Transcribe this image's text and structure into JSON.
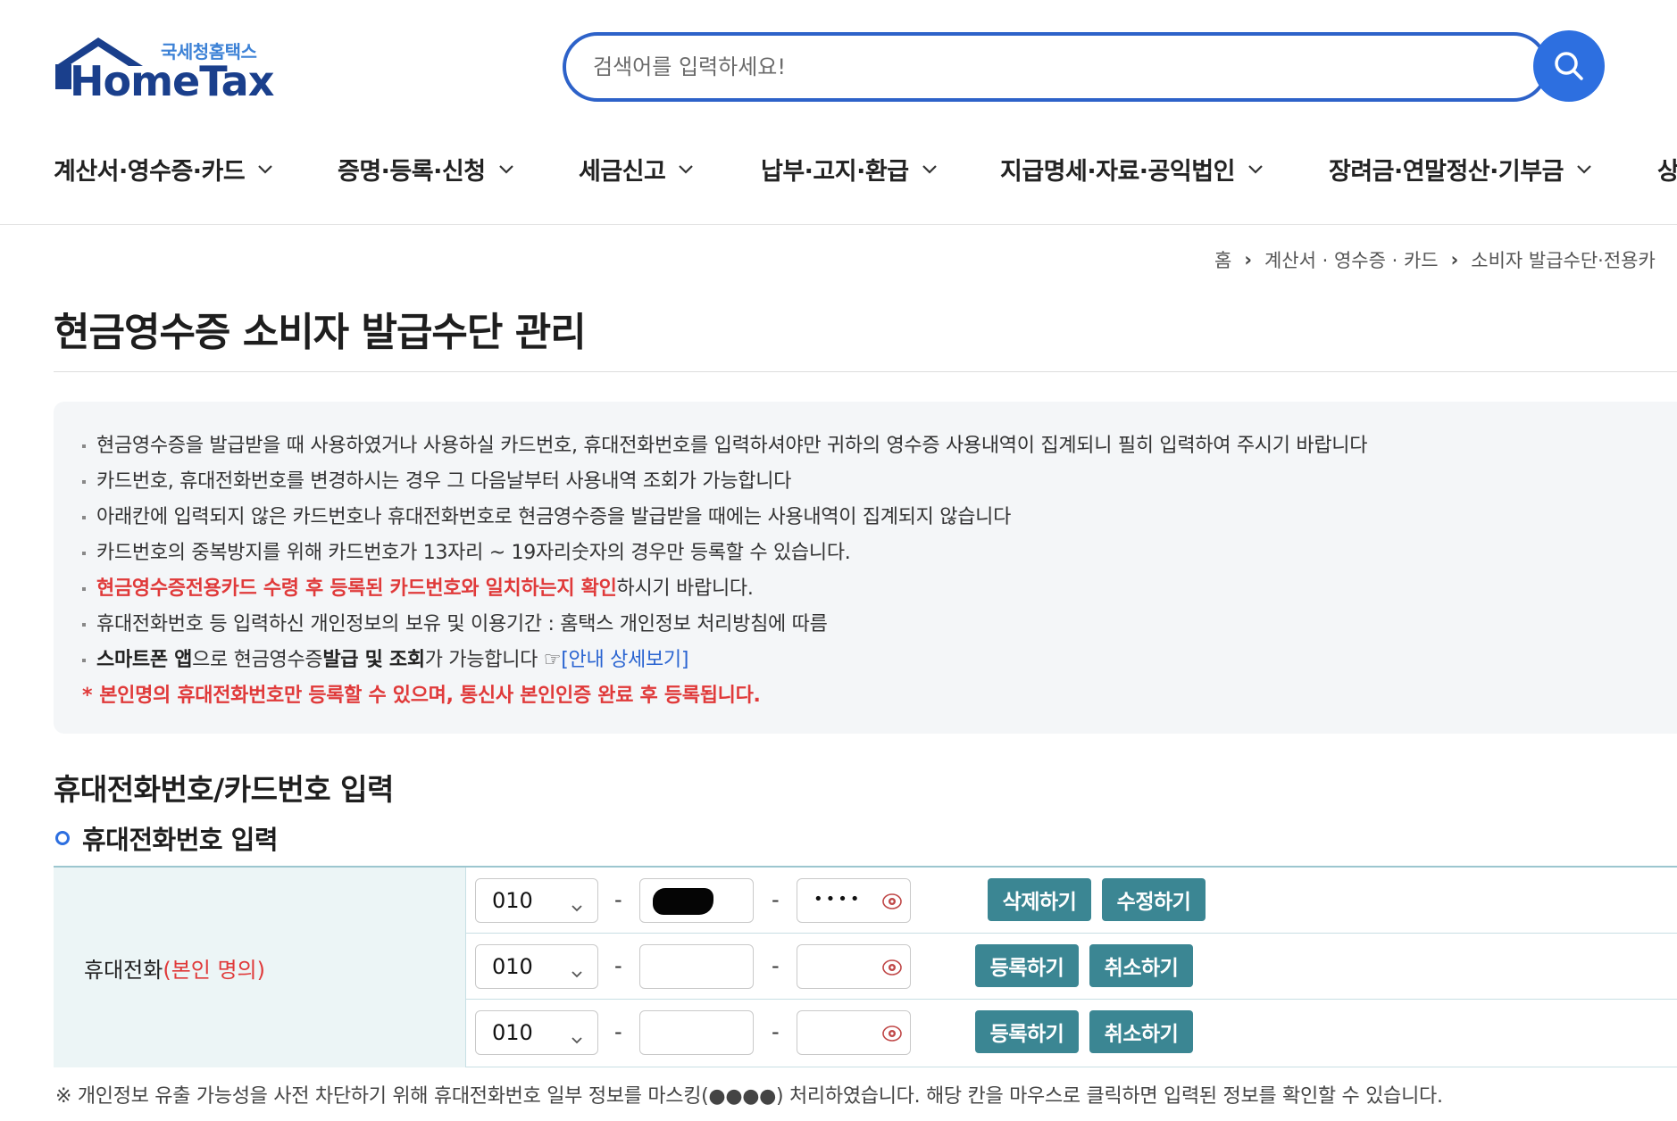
{
  "logo": {
    "sub": "국세청홈택스",
    "main": "HomeTax"
  },
  "search": {
    "placeholder": "검색어를 입력하세요!"
  },
  "gnb": [
    {
      "label": "계산서·영수증·카드"
    },
    {
      "label": "증명·등록·신청"
    },
    {
      "label": "세금신고"
    },
    {
      "label": "납부·고지·환급"
    },
    {
      "label": "지급명세·자료·공익법인"
    },
    {
      "label": "장려금·연말정산·기부금"
    },
    {
      "label": "상"
    }
  ],
  "breadcrumb": [
    "홈",
    "계산서 · 영수증 · 카드",
    "소비자 발급수단·전용카"
  ],
  "page_title": "현금영수증 소비자 발급수단 관리",
  "notice": {
    "l1": "현금영수증을 발급받을 때 사용하였거나 사용하실 카드번호, 휴대전화번호를 입력하셔야만 귀하의 영수증 사용내역이 집계되니 필히 입력하여 주시기 바랍니다",
    "l2": "카드번호, 휴대전화번호를 변경하시는 경우 그 다음날부터 사용내역 조회가 가능합니다",
    "l3": "아래칸에 입력되지 않은 카드번호나 휴대전화번호로 현금영수증을 발급받을 때에는 사용내역이 집계되지 않습니다",
    "l4": "카드번호의 중복방지를 위해 카드번호가 13자리 ~ 19자리숫자의 경우만 등록할 수 있습니다.",
    "l5_red": "현금영수증전용카드 수령 후 등록된 카드번호와 일치하는지 확인",
    "l5_rest": "하시기 바랍니다.",
    "l6": "휴대전화번호 등 입력하신 개인정보의 보유 및 이용기간 : 홈택스 개인정보 처리방침에 따름",
    "l7_a": "스마트폰 앱",
    "l7_b": "으로 현금영수증 ",
    "l7_c": "발급 및 조회",
    "l7_d": "가 가능합니다 ☞ ",
    "l7_link": "[안내 상세보기]",
    "l8_star": "*",
    "l8": "본인명의 휴대전화번호만 등록할 수 있으며, 통신사 본인인증 완료 후 등록됩니다."
  },
  "section_title": "휴대전화번호/카드번호 입력",
  "sub_title": "휴대전화번호 입력",
  "phone_table": {
    "label": "휴대전화",
    "label_red": "(본인 명의)",
    "rows": [
      {
        "prefix": "010",
        "last_masked": "••••",
        "btn1": "삭제하기",
        "btn2": "수정하기"
      },
      {
        "prefix": "010",
        "btn1": "등록하기",
        "btn2": "취소하기"
      },
      {
        "prefix": "010",
        "btn1": "등록하기",
        "btn2": "취소하기"
      }
    ],
    "dash": "-"
  },
  "footnote": "※ 개인정보 유출 가능성을 사전 차단하기 위해 휴대전화번호 일부 정보를 마스킹(●●●●) 처리하였습니다. 해당 칸을 마우스로 클릭하면 입력된 정보를 확인할 수 있습니다.",
  "colors": {
    "brand": "#1a3f8c",
    "accent": "#2d6fe0",
    "button": "#3b8693",
    "red": "#e03a3a"
  },
  "icons": {
    "search": "search-icon",
    "chevron": "chevron-down-icon",
    "eye": "eye-icon"
  }
}
